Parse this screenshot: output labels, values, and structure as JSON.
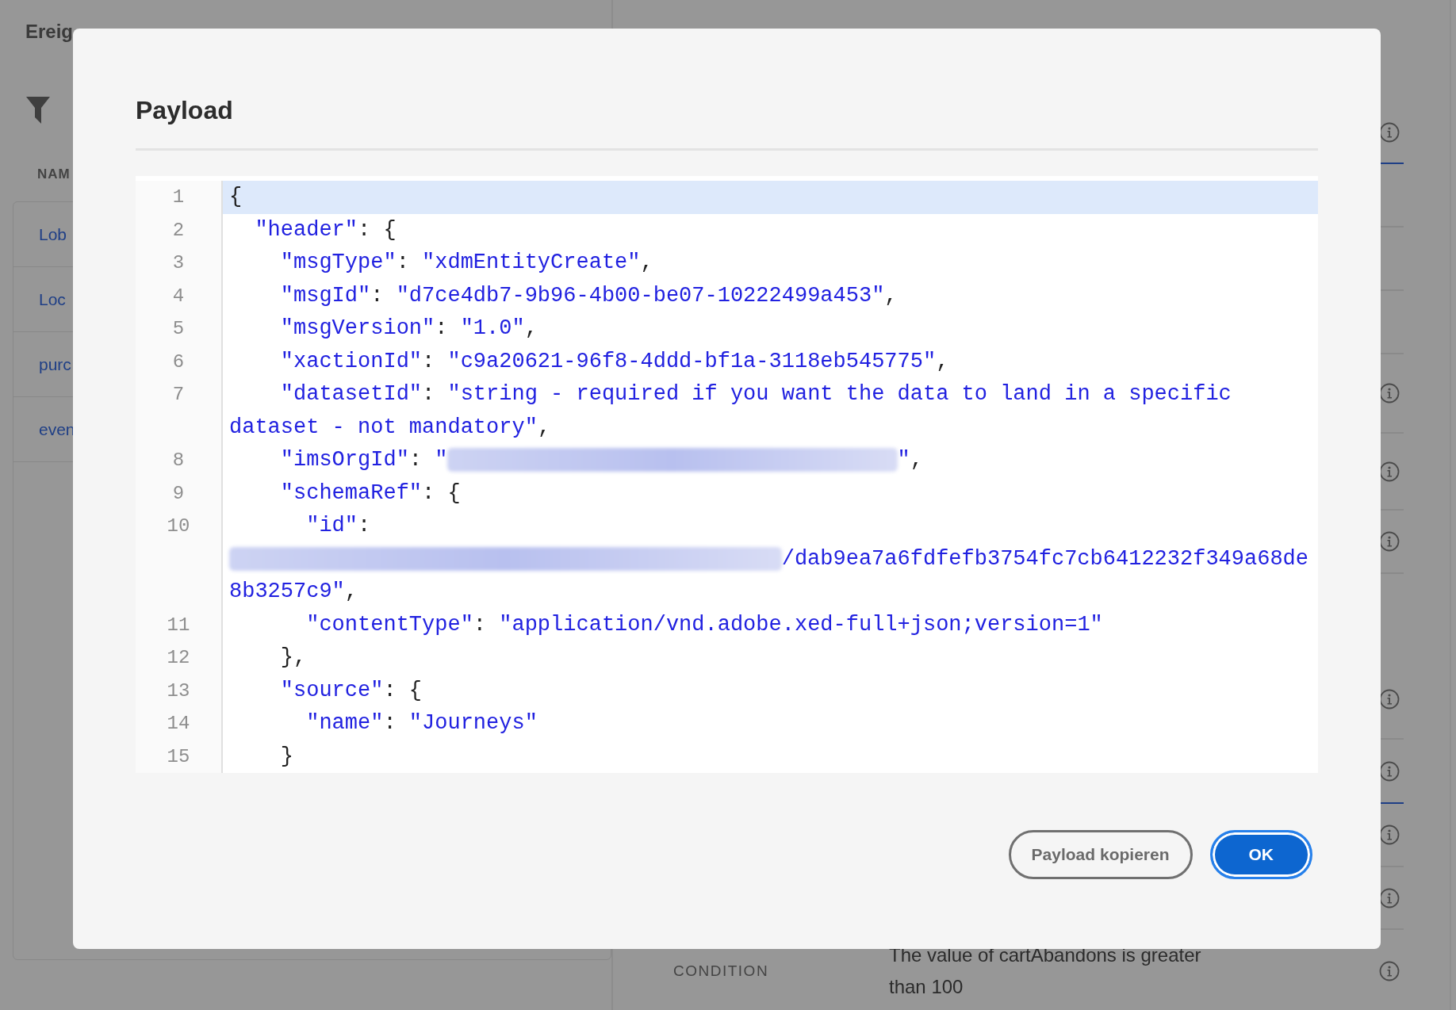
{
  "background_page": {
    "left_panel": {
      "title": "Ereig",
      "column_header": "NAM",
      "rows": [
        "Lob",
        "Loc",
        "purc",
        "even"
      ]
    },
    "right_panel": {
      "condition": {
        "label": "CONDITION",
        "value": "The value of cartAbandons is greater than 100"
      }
    }
  },
  "dialog": {
    "title": "Payload",
    "code_lines": [
      {
        "number": "1",
        "highlighted": true,
        "tokens": [
          {
            "kind": "punct",
            "text": "{"
          }
        ]
      },
      {
        "number": "2",
        "highlighted": false,
        "tokens": [
          {
            "kind": "key",
            "text": "  \"header\""
          },
          {
            "kind": "punct",
            "text": ": {"
          }
        ]
      },
      {
        "number": "3",
        "highlighted": false,
        "tokens": [
          {
            "kind": "key",
            "text": "    \"msgType\""
          },
          {
            "kind": "punct",
            "text": ": "
          },
          {
            "kind": "string",
            "text": "\"xdmEntityCreate\""
          },
          {
            "kind": "punct",
            "text": ","
          }
        ]
      },
      {
        "number": "4",
        "highlighted": false,
        "tokens": [
          {
            "kind": "key",
            "text": "    \"msgId\""
          },
          {
            "kind": "punct",
            "text": ": "
          },
          {
            "kind": "string",
            "text": "\"d7ce4db7-9b96-4b00-be07-10222499a453\""
          },
          {
            "kind": "punct",
            "text": ","
          }
        ]
      },
      {
        "number": "5",
        "highlighted": false,
        "tokens": [
          {
            "kind": "key",
            "text": "    \"msgVersion\""
          },
          {
            "kind": "punct",
            "text": ": "
          },
          {
            "kind": "string",
            "text": "\"1.0\""
          },
          {
            "kind": "punct",
            "text": ","
          }
        ]
      },
      {
        "number": "6",
        "highlighted": false,
        "tokens": [
          {
            "kind": "key",
            "text": "    \"xactionId\""
          },
          {
            "kind": "punct",
            "text": ": "
          },
          {
            "kind": "string",
            "text": "\"c9a20621-96f8-4ddd-bf1a-3118eb545775\""
          },
          {
            "kind": "punct",
            "text": ","
          }
        ]
      },
      {
        "number": "7",
        "highlighted": false,
        "tokens": [
          {
            "kind": "key",
            "text": "    \"datasetId\""
          },
          {
            "kind": "punct",
            "text": ": "
          },
          {
            "kind": "string",
            "text": "\"string - required if you want the data to land in a specific dataset - not mandatory\""
          },
          {
            "kind": "punct",
            "text": ","
          }
        ]
      },
      {
        "number": "8",
        "highlighted": false,
        "tokens": [
          {
            "kind": "key",
            "text": "    \"imsOrgId\""
          },
          {
            "kind": "punct",
            "text": ": "
          },
          {
            "kind": "string",
            "text": "\""
          },
          {
            "kind": "redacted"
          },
          {
            "kind": "string",
            "text": "\""
          },
          {
            "kind": "punct",
            "text": ","
          }
        ]
      },
      {
        "number": "9",
        "highlighted": false,
        "tokens": [
          {
            "kind": "key",
            "text": "    \"schemaRef\""
          },
          {
            "kind": "punct",
            "text": ": {"
          }
        ]
      },
      {
        "number": "10",
        "highlighted": false,
        "tokens": [
          {
            "kind": "key",
            "text": "      \"id\""
          },
          {
            "kind": "punct",
            "text": ": "
          },
          {
            "kind": "redacted"
          },
          {
            "kind": "string",
            "text": "/dab9ea7a6fdfefb3754fc7cb6412232f349a68de8b3257c9\""
          },
          {
            "kind": "punct",
            "text": ","
          }
        ]
      },
      {
        "number": "11",
        "highlighted": false,
        "tokens": [
          {
            "kind": "key",
            "text": "      \"contentType\""
          },
          {
            "kind": "punct",
            "text": ": "
          },
          {
            "kind": "string",
            "text": "\"application/vnd.adobe.xed-full+json;version=1\""
          }
        ]
      },
      {
        "number": "12",
        "highlighted": false,
        "tokens": [
          {
            "kind": "punct",
            "text": "    },"
          }
        ]
      },
      {
        "number": "13",
        "highlighted": false,
        "tokens": [
          {
            "kind": "key",
            "text": "    \"source\""
          },
          {
            "kind": "punct",
            "text": ": {"
          }
        ]
      },
      {
        "number": "14",
        "highlighted": false,
        "tokens": [
          {
            "kind": "key",
            "text": "      \"name\""
          },
          {
            "kind": "punct",
            "text": ": "
          },
          {
            "kind": "string",
            "text": "\"Journeys\""
          }
        ]
      },
      {
        "number": "15",
        "highlighted": false,
        "tokens": [
          {
            "kind": "punct",
            "text": "    }"
          }
        ]
      }
    ],
    "buttons": [
      {
        "label": "Payload kopieren",
        "kind": "secondary"
      },
      {
        "label": "OK",
        "kind": "primary"
      }
    ]
  }
}
